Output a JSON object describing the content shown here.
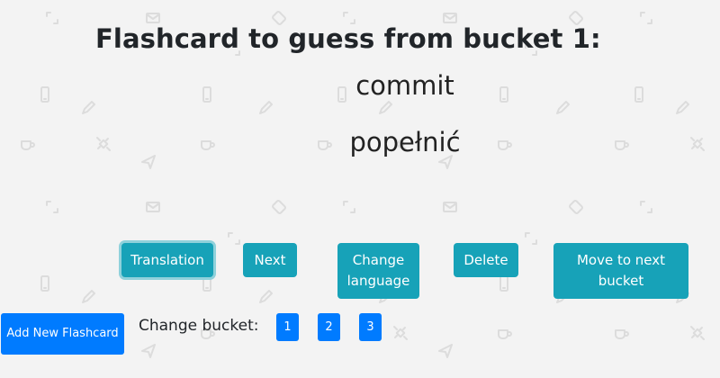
{
  "card": {
    "title": "Flashcard to guess from bucket 1:",
    "front_word": "commit",
    "back_word": "popełnić"
  },
  "actions": {
    "translation": "Translation",
    "next": "Next",
    "change_language": "Change language",
    "delete": "Delete",
    "move_to_next_bucket": "Move to next bucket"
  },
  "footer": {
    "add_new": "Add New Flashcard",
    "change_bucket_label": "Change bucket:",
    "buckets": [
      "1",
      "2",
      "3"
    ]
  },
  "colors": {
    "background": "#f3f3f3",
    "info": "#17a2b8",
    "primary": "#007bff",
    "pattern": "#dcdcdc"
  },
  "background_icons": [
    "mail-icon",
    "phone-icon",
    "pencil-icon",
    "coffee-icon",
    "expand-icon",
    "send-icon",
    "satellite-icon",
    "mobile-icon"
  ]
}
